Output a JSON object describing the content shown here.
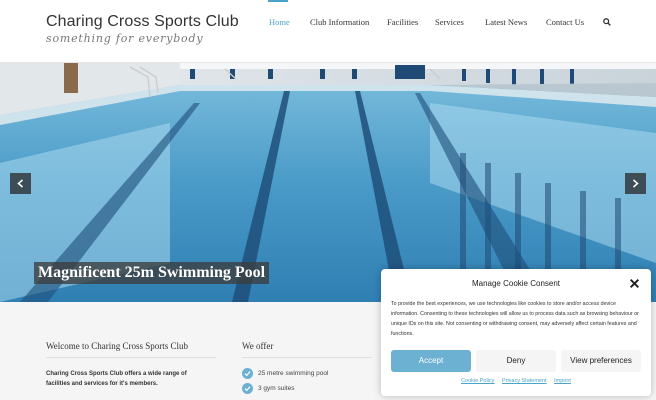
{
  "header": {
    "title": "Charing Cross Sports Club",
    "tagline": "something for everybody",
    "nav": [
      {
        "label": "Home",
        "active": true
      },
      {
        "label": "Club Information",
        "active": false
      },
      {
        "label": "Facilities",
        "active": false
      },
      {
        "label": "Services",
        "active": false
      },
      {
        "label": "Latest News",
        "active": false
      },
      {
        "label": "Contact Us",
        "active": false
      }
    ],
    "search_icon": "search-icon"
  },
  "hero": {
    "caption": "Magnificent 25m Swimming Pool",
    "prev_icon": "chevron-left-icon",
    "next_icon": "chevron-right-icon"
  },
  "welcome": {
    "title": "Welcome to Charing Cross Sports Club",
    "text": "Charing Cross Sports Club offers a wide range of facilities and services for it's members."
  },
  "offer": {
    "title": "We offer",
    "items": [
      "25 metre swimming pool",
      "3 gym suites"
    ]
  },
  "cookie": {
    "title": "Manage Cookie Consent",
    "text": "To provide the best experiences, we use technologies like cookies to store and/or access device information. Consenting to these technologies will allow us to process data such as browsing behaviour or unique IDs on this site. Not consenting or withdrawing consent, may adversely affect certain features and functions.",
    "accept": "Accept",
    "deny": "Deny",
    "preferences": "View preferences",
    "links": [
      "Cookie Policy",
      "Privacy Statement",
      "Imprint"
    ]
  },
  "colors": {
    "accent": "#6cb1d2",
    "nav_active": "#4aa3c8"
  }
}
